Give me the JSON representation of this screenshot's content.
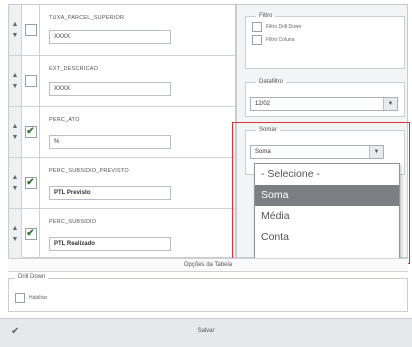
{
  "fields": [
    {
      "name": "TUXA_PARCEL_SUPERIOR",
      "value": "XXXX",
      "checked": false,
      "bold": false
    },
    {
      "name": "EXT_DESCRICAO",
      "value": "XXXX",
      "checked": false,
      "bold": false
    },
    {
      "name": "PERC_ATO",
      "value": "%",
      "checked": true,
      "bold": false
    },
    {
      "name": "PERC_SUBSIDIO_PREVISTO",
      "value": "PTL Previsto",
      "checked": true,
      "bold": true
    },
    {
      "name": "PERC_SUBSIDIO",
      "value": "PTL Realizado",
      "checked": true,
      "bold": true
    }
  ],
  "options_bar": "Opções da Tabela",
  "filtro": {
    "legend": "Filtro",
    "items": [
      "Filtro Drill Down",
      "Filtro Coluna"
    ]
  },
  "datafiltro": {
    "legend": "Datafiltro",
    "value": "12/02"
  },
  "somar": {
    "legend": "Somar",
    "value": "Soma",
    "options": [
      "- Selecione -",
      "Soma",
      "Média",
      "Conta"
    ],
    "selected_index": 1
  },
  "drill_down": {
    "legend": "Drill Down",
    "checkbox_label": "Habilitar"
  },
  "save_label": "Salvar",
  "icons": {
    "up": "▲",
    "down": "▼",
    "check": "✔",
    "caret": "▼"
  }
}
